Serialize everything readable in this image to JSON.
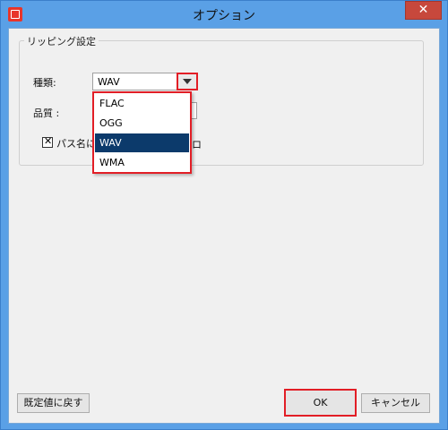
{
  "window": {
    "title": "オプション",
    "close_label": "✕"
  },
  "group": {
    "title": "リッピング設定"
  },
  "format": {
    "label": "種類:",
    "value": "WAV",
    "options": [
      "FLAC",
      "OGG",
      "WAV",
      "WMA"
    ],
    "selected_index": 2
  },
  "quality": {
    "label": "品質 :"
  },
  "filename_option": {
    "label": "パス名に",
    "trailing": "ロ",
    "checked": true,
    "check_mark": "✕"
  },
  "buttons": {
    "reset": "既定値に戻す",
    "ok": "OK",
    "cancel": "キャンセル"
  },
  "colors": {
    "frame": "#5aa0e6",
    "highlight_box": "#e21e26",
    "selected": "#0c3a6b",
    "close": "#c7483c"
  }
}
